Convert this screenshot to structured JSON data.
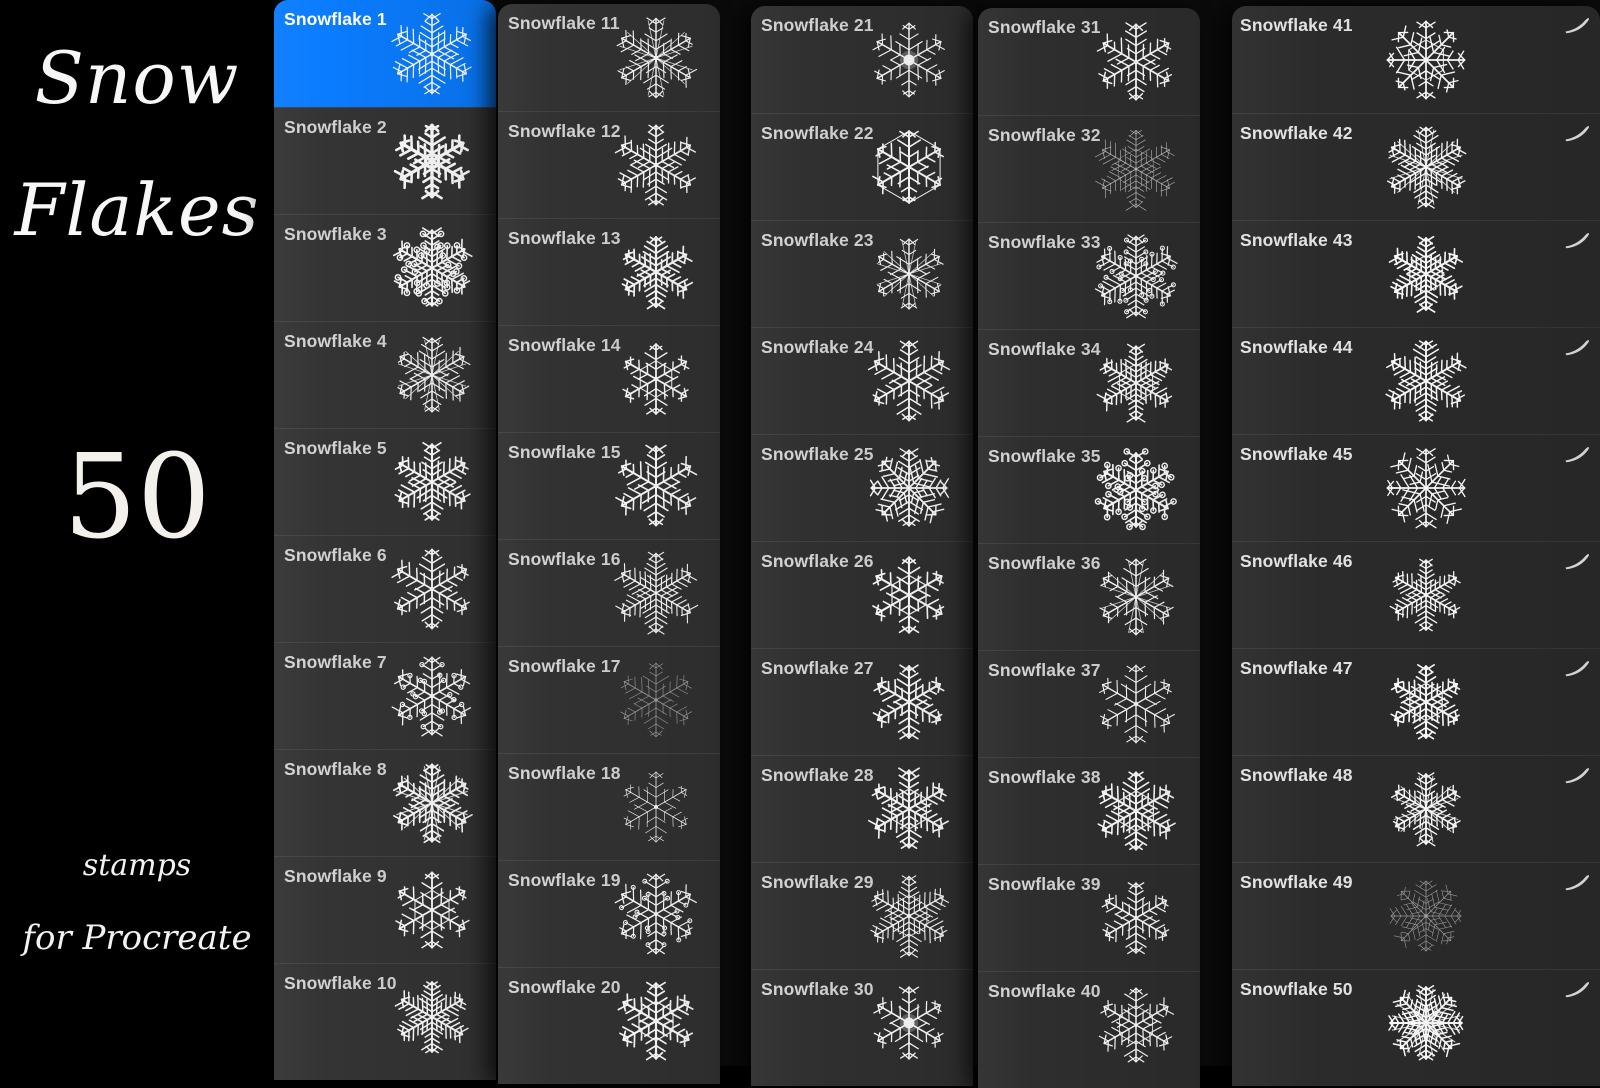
{
  "promo": {
    "title_line1": "Snow",
    "title_line2": "Flakes",
    "count": "50",
    "sub_line1": "stamps",
    "sub_line2": "for Procreate"
  },
  "library": {
    "selected_index": 0,
    "accent_color": "#0a7cff",
    "panel_color": "#343434",
    "label_color": "#d2d2d2",
    "row_count_per_column": 10,
    "columns": [
      {
        "id": "col-1",
        "has_swipe_icons": false,
        "rows": [
          {
            "label": "Snowflake 1",
            "selected": true,
            "flake": "dendrite-fern"
          },
          {
            "label": "Snowflake 2",
            "selected": false,
            "flake": "bold-classic"
          },
          {
            "label": "Snowflake 3",
            "selected": false,
            "flake": "dotted-star"
          },
          {
            "label": "Snowflake 4",
            "selected": false,
            "flake": "needle-fern"
          },
          {
            "label": "Snowflake 5",
            "selected": false,
            "flake": "ringed-hex"
          },
          {
            "label": "Snowflake 6",
            "selected": false,
            "flake": "spiky-fern"
          },
          {
            "label": "Snowflake 7",
            "selected": false,
            "flake": "bubble-hex"
          },
          {
            "label": "Snowflake 8",
            "selected": false,
            "flake": "burst-fern"
          },
          {
            "label": "Snowflake 9",
            "selected": false,
            "flake": "lattice-fern"
          },
          {
            "label": "Snowflake 10",
            "selected": false,
            "flake": "wide-dendrite"
          }
        ]
      },
      {
        "id": "col-2",
        "has_swipe_icons": false,
        "rows": [
          {
            "label": "Snowflake 11",
            "selected": false,
            "flake": "radial-burst"
          },
          {
            "label": "Snowflake 12",
            "selected": false,
            "flake": "dense-dendrite"
          },
          {
            "label": "Snowflake 13",
            "selected": false,
            "flake": "sparse-fern"
          },
          {
            "label": "Snowflake 14",
            "selected": false,
            "flake": "wide-plate"
          },
          {
            "label": "Snowflake 15",
            "selected": false,
            "flake": "fine-star"
          },
          {
            "label": "Snowflake 16",
            "selected": false,
            "flake": "crisp-star"
          },
          {
            "label": "Snowflake 17",
            "selected": false,
            "flake": "faint-star"
          },
          {
            "label": "Snowflake 18",
            "selected": false,
            "flake": "thin-star"
          },
          {
            "label": "Snowflake 19",
            "selected": false,
            "flake": "bubble-hex"
          },
          {
            "label": "Snowflake 20",
            "selected": false,
            "flake": "ornate-plate"
          }
        ]
      },
      {
        "id": "col-3",
        "has_swipe_icons": false,
        "rows": [
          {
            "label": "Snowflake 21",
            "selected": false,
            "flake": "glow-core"
          },
          {
            "label": "Snowflake 22",
            "selected": false,
            "flake": "hex-outline"
          },
          {
            "label": "Snowflake 23",
            "selected": false,
            "flake": "tall-needle"
          },
          {
            "label": "Snowflake 24",
            "selected": false,
            "flake": "sharp-star"
          },
          {
            "label": "Snowflake 25",
            "selected": false,
            "flake": "crossed-fern"
          },
          {
            "label": "Snowflake 26",
            "selected": false,
            "flake": "diamond-lattice"
          },
          {
            "label": "Snowflake 27",
            "selected": false,
            "flake": "slim-fern"
          },
          {
            "label": "Snowflake 28",
            "selected": false,
            "flake": "tiny-plate"
          },
          {
            "label": "Snowflake 29",
            "selected": false,
            "flake": "round-lattice"
          },
          {
            "label": "Snowflake 30",
            "selected": false,
            "flake": "glow-dendrite"
          }
        ]
      },
      {
        "id": "col-4",
        "has_swipe_icons": false,
        "rows": [
          {
            "label": "Snowflake 31",
            "selected": false,
            "flake": "feather-star"
          },
          {
            "label": "Snowflake 32",
            "selected": false,
            "flake": "soft-plate"
          },
          {
            "label": "Snowflake 33",
            "selected": false,
            "flake": "beaded-star"
          },
          {
            "label": "Snowflake 34",
            "selected": false,
            "flake": "tilted-plate"
          },
          {
            "label": "Snowflake 35",
            "selected": false,
            "flake": "beaded-column"
          },
          {
            "label": "Snowflake 36",
            "selected": false,
            "flake": "spray-burst"
          },
          {
            "label": "Snowflake 37",
            "selected": false,
            "flake": "small-dendrite"
          },
          {
            "label": "Snowflake 38",
            "selected": false,
            "flake": "blocky-plate"
          },
          {
            "label": "Snowflake 39",
            "selected": false,
            "flake": "large-dendrite"
          },
          {
            "label": "Snowflake 40",
            "selected": false,
            "flake": "mini-plate"
          }
        ]
      },
      {
        "id": "col-5",
        "has_swipe_icons": true,
        "rows": [
          {
            "label": "Snowflake 41",
            "selected": false,
            "flake": "cross-plate"
          },
          {
            "label": "Snowflake 42",
            "selected": false,
            "flake": "ray-star"
          },
          {
            "label": "Snowflake 43",
            "selected": false,
            "flake": "disc-lace"
          },
          {
            "label": "Snowflake 44",
            "selected": false,
            "flake": "arrow-star"
          },
          {
            "label": "Snowflake 45",
            "selected": false,
            "flake": "barb-cross"
          },
          {
            "label": "Snowflake 46",
            "selected": false,
            "flake": "scaled-fern"
          },
          {
            "label": "Snowflake 47",
            "selected": false,
            "flake": "wide-lace"
          },
          {
            "label": "Snowflake 48",
            "selected": false,
            "flake": "needle-burst"
          },
          {
            "label": "Snowflake 49",
            "selected": false,
            "flake": "faint-cross"
          },
          {
            "label": "Snowflake 50",
            "selected": false,
            "flake": "eight-ray"
          }
        ]
      }
    ]
  },
  "icons": {
    "swipe": "brush-stroke-swipe-icon"
  }
}
